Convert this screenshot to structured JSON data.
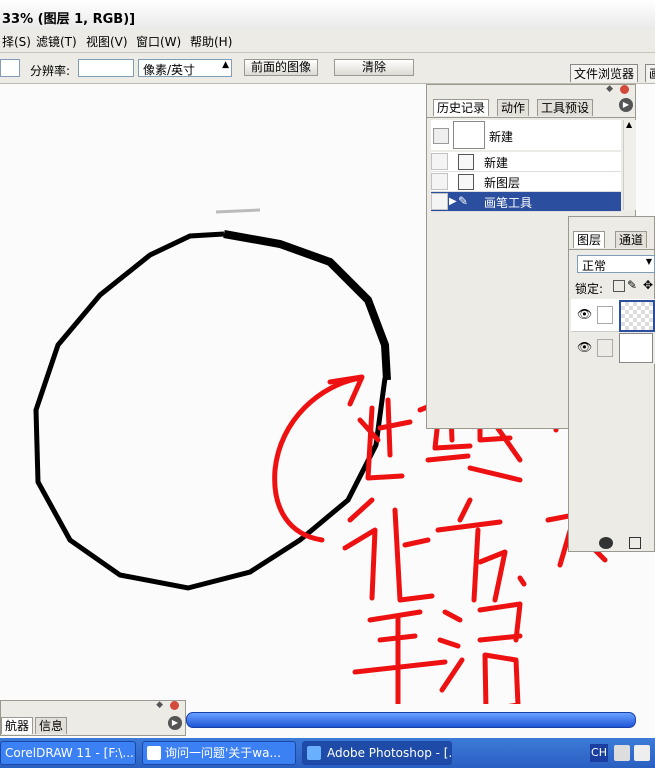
{
  "window": {
    "title": "33% (图层 1, RGB)]"
  },
  "menu": {
    "items": [
      "择(S)",
      "滤镜(T)",
      "视图(V)",
      "窗口(W)",
      "帮助(H)"
    ]
  },
  "options": {
    "resolution_label": "分辨率:",
    "unit_value": "像素/英寸",
    "front_image_label": "前面的图像",
    "clear_label": "清除",
    "file_browser_tab": "文件浏览器",
    "extra_tab": "画"
  },
  "history_panel": {
    "tabs": [
      "历史记录",
      "动作",
      "工具预设"
    ],
    "snapshot_label": "新建",
    "rows": [
      "新建",
      "新图层",
      "画笔工具"
    ]
  },
  "layers_panel": {
    "tabs": [
      "图层",
      "通道"
    ],
    "blend_mode": "正常",
    "lock_label": "锁定:"
  },
  "navigator_panel": {
    "tabs": [
      "航器",
      "信息"
    ]
  },
  "taskbar": {
    "tasks": [
      "CorelDRAW 11 - [F:\\...",
      "询问一问题'关于wa...",
      "Adobe Photoshop - [..."
    ],
    "lang": "CH"
  },
  "annotation": {
    "text": "这些边缘很方、不平滑"
  },
  "colors": {
    "annotation": "#ee1111",
    "selection": "#2b4e9e",
    "taskbar": "#2a5fc2"
  }
}
